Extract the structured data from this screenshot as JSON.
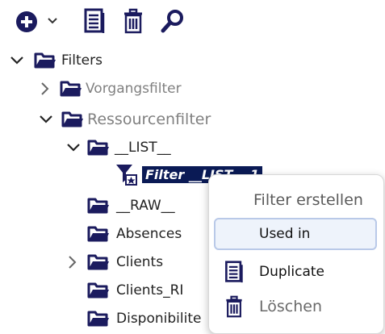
{
  "toolbar": {
    "add_icon": "add-circle-icon",
    "dropdown_icon": "chevron-down-icon",
    "notes_icon": "document-list-icon",
    "delete_icon": "trash-icon",
    "search_icon": "magnifier-icon"
  },
  "tree": {
    "root": "Filters",
    "vorgang": "Vorgangsfilter",
    "ressourcen": "Ressourcenfilter",
    "list": "__LIST__",
    "selected_filter": "Filter __LIST__ 1",
    "raw": "__RAW__",
    "absences": "Absences",
    "clients": "Clients",
    "clients_ri": "Clients_RI",
    "disponibilite": "Disponibilite"
  },
  "context_menu": {
    "title": "Filter erstellen",
    "used_in": "Used in",
    "duplicate": "Duplicate",
    "delete": "Löschen"
  },
  "colors": {
    "icon_navy": "#1b1b5e",
    "selection_bg": "#0a1a55",
    "muted_text": "#808080"
  }
}
